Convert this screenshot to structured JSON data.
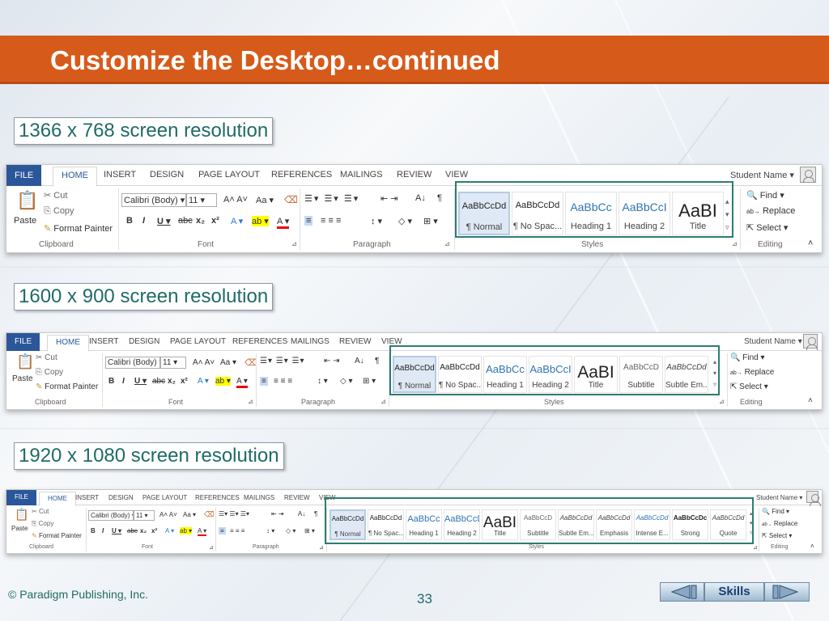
{
  "slide": {
    "title": "Customize the Desktop…continued",
    "copyright": "© Paradigm Publishing, Inc.",
    "page_number": "33",
    "skills_label": "Skills"
  },
  "resolutions": [
    {
      "label": "1366 x 768 screen resolution"
    },
    {
      "label": "1600 x 900 screen resolution"
    },
    {
      "label": "1920 x 1080 screen resolution"
    }
  ],
  "ribbon": {
    "tabs": [
      "FILE",
      "HOME",
      "INSERT",
      "DESIGN",
      "PAGE LAYOUT",
      "REFERENCES",
      "MAILINGS",
      "REVIEW",
      "VIEW"
    ],
    "user": "Student Name",
    "clipboard": {
      "paste": "Paste",
      "cut": "Cut",
      "copy": "Copy",
      "format_painter": "Format Painter",
      "label": "Clipboard"
    },
    "font": {
      "name": "Calibri (Body)",
      "size": "11",
      "label": "Font"
    },
    "paragraph_label": "Paragraph",
    "styles_label": "Styles",
    "editing": {
      "find": "Find",
      "replace": "Replace",
      "select": "Select",
      "label": "Editing"
    },
    "styles_1366": [
      {
        "preview": "AaBbCcDd",
        "name": "¶ Normal"
      },
      {
        "preview": "AaBbCcDd",
        "name": "¶ No Spac..."
      },
      {
        "preview": "AaBbCc",
        "name": "Heading 1"
      },
      {
        "preview": "AaBbCcI",
        "name": "Heading 2"
      },
      {
        "preview": "AaBI",
        "name": "Title"
      }
    ],
    "styles_1600": [
      {
        "preview": "AaBbCcDd",
        "name": "¶ Normal"
      },
      {
        "preview": "AaBbCcDd",
        "name": "¶ No Spac..."
      },
      {
        "preview": "AaBbCc",
        "name": "Heading 1"
      },
      {
        "preview": "AaBbCcI",
        "name": "Heading 2"
      },
      {
        "preview": "AaBI",
        "name": "Title"
      },
      {
        "preview": "AaBbCcD",
        "name": "Subtitle"
      },
      {
        "preview": "AaBbCcDd",
        "name": "Subtle Em..."
      }
    ],
    "styles_1920": [
      {
        "preview": "AaBbCcDd",
        "name": "¶ Normal"
      },
      {
        "preview": "AaBbCcDd",
        "name": "¶ No Spac..."
      },
      {
        "preview": "AaBbCc",
        "name": "Heading 1"
      },
      {
        "preview": "AaBbCcD",
        "name": "Heading 2"
      },
      {
        "preview": "AaBI",
        "name": "Title"
      },
      {
        "preview": "AaBbCcD",
        "name": "Subtitle"
      },
      {
        "preview": "AaBbCcDd",
        "name": "Subtle Em..."
      },
      {
        "preview": "AaBbCcDd",
        "name": "Emphasis"
      },
      {
        "preview": "AaBbCcDd",
        "name": "Intense E..."
      },
      {
        "preview": "AaBbCcDc",
        "name": "Strong"
      },
      {
        "preview": "AaBbCcDd",
        "name": "Quote"
      }
    ]
  },
  "colors": {
    "accent": "#d65b1b",
    "word_blue": "#2b579a",
    "callout": "#2e7c6f",
    "label_text": "#1f6b66"
  }
}
